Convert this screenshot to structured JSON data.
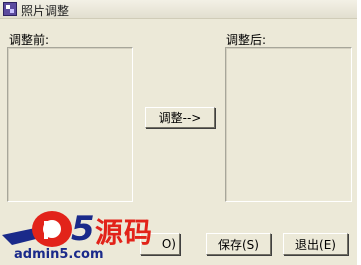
{
  "window": {
    "title": "照片调整"
  },
  "labels": {
    "before": "调整前:",
    "after": "调整后:"
  },
  "buttons": {
    "adjust": "调整-->",
    "ok_partial": "O)",
    "save": "保存(S)",
    "exit": "退出(E)"
  },
  "watermark": {
    "logo_letter": "a",
    "logo_digit": "5",
    "logo_cn": "源码",
    "site": "admin5.com"
  },
  "colors": {
    "window_bg": "#ece9d8",
    "watermark_red": "#e2231a",
    "watermark_blue": "#1a2a8a"
  },
  "icons": {
    "app_icon": "app-icon"
  }
}
